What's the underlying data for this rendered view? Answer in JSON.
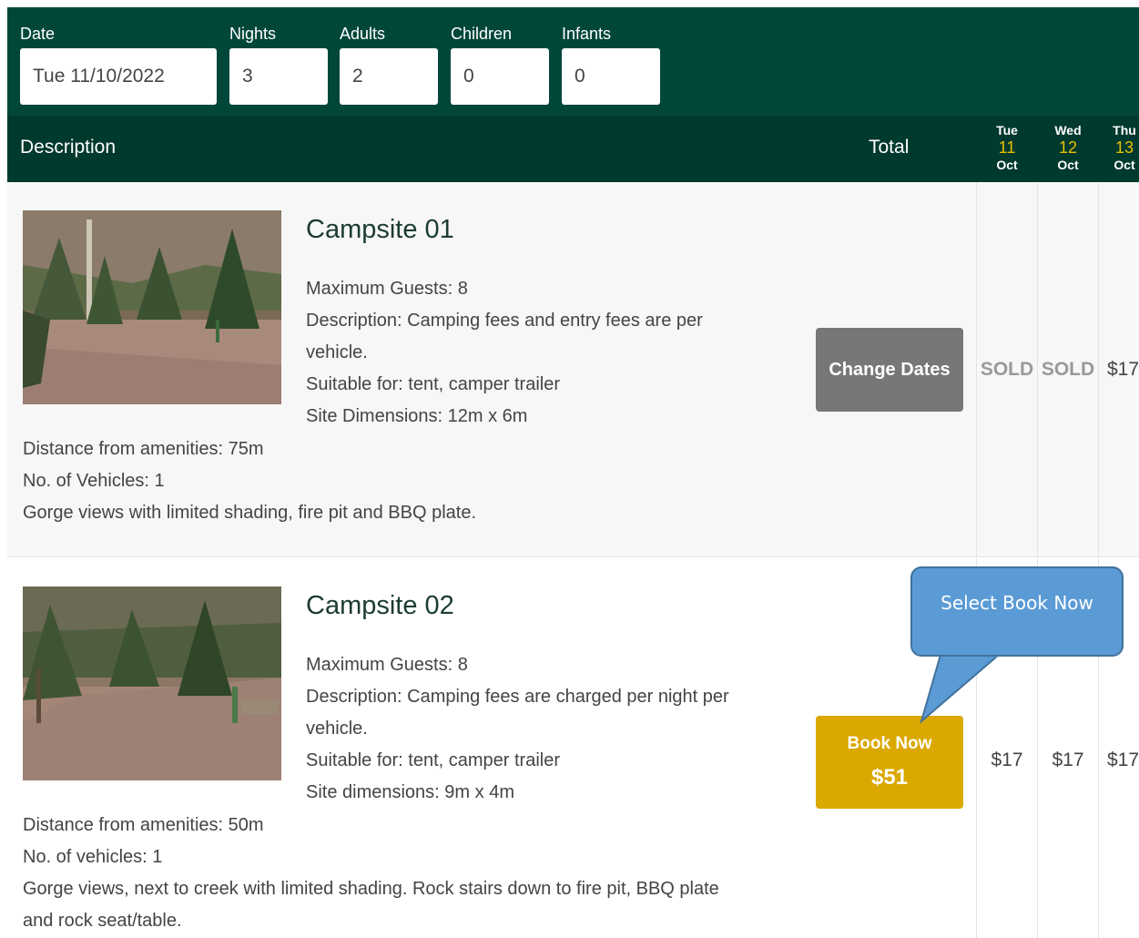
{
  "search": {
    "date_label": "Date",
    "date_value": "Tue 11/10/2022",
    "nights_label": "Nights",
    "nights_value": "3",
    "adults_label": "Adults",
    "adults_value": "2",
    "children_label": "Children",
    "children_value": "0",
    "infants_label": "Infants",
    "infants_value": "0"
  },
  "header": {
    "description": "Description",
    "total": "Total",
    "days": [
      {
        "dow": "Tue",
        "dom": "11",
        "mon": "Oct"
      },
      {
        "dow": "Wed",
        "dom": "12",
        "mon": "Oct"
      },
      {
        "dow": "Thu",
        "dom": "13",
        "mon": "Oct"
      }
    ]
  },
  "sites": [
    {
      "title": "Campsite 01",
      "max_guests": "Maximum Guests:  8",
      "desc_1": "Description:  Camping fees and entry fees are per",
      "desc_2": "vehicle.",
      "suitable": "Suitable for: tent, camper trailer",
      "dimensions": "Site Dimensions: 12m x 6m",
      "distance": "Distance from amenities: 75m",
      "vehicles": "No. of Vehicles: 1",
      "notes_1": "Gorge views with limited shading, fire pit and BBQ plate.",
      "button": "Change Dates",
      "prices": [
        "SOLD",
        "SOLD",
        "$17"
      ]
    },
    {
      "title": "Campsite 02",
      "max_guests": "Maximum Guests:  8",
      "desc_1": "Description:  Camping fees are charged per night per",
      "desc_2": "vehicle.",
      "suitable": "Suitable for: tent, camper trailer",
      "dimensions": "Site dimensions: 9m x 4m",
      "distance": "Distance from amenities: 50m",
      "vehicles": "No. of vehicles: 1",
      "notes_1": "Gorge views, next to creek with limited shading. Rock stairs down to fire pit, BBQ plate",
      "notes_2": "and rock seat/table.",
      "button": "Book Now",
      "button_price": "$51",
      "prices": [
        "$17",
        "$17",
        "$17"
      ]
    }
  ],
  "callout": {
    "text": "Select Book Now"
  },
  "colors": {
    "brand_dark": "#00473a",
    "header": "#00392d",
    "accent": "#dba800",
    "date_highlight": "#e6c100",
    "callout": "#5b9bd5"
  }
}
